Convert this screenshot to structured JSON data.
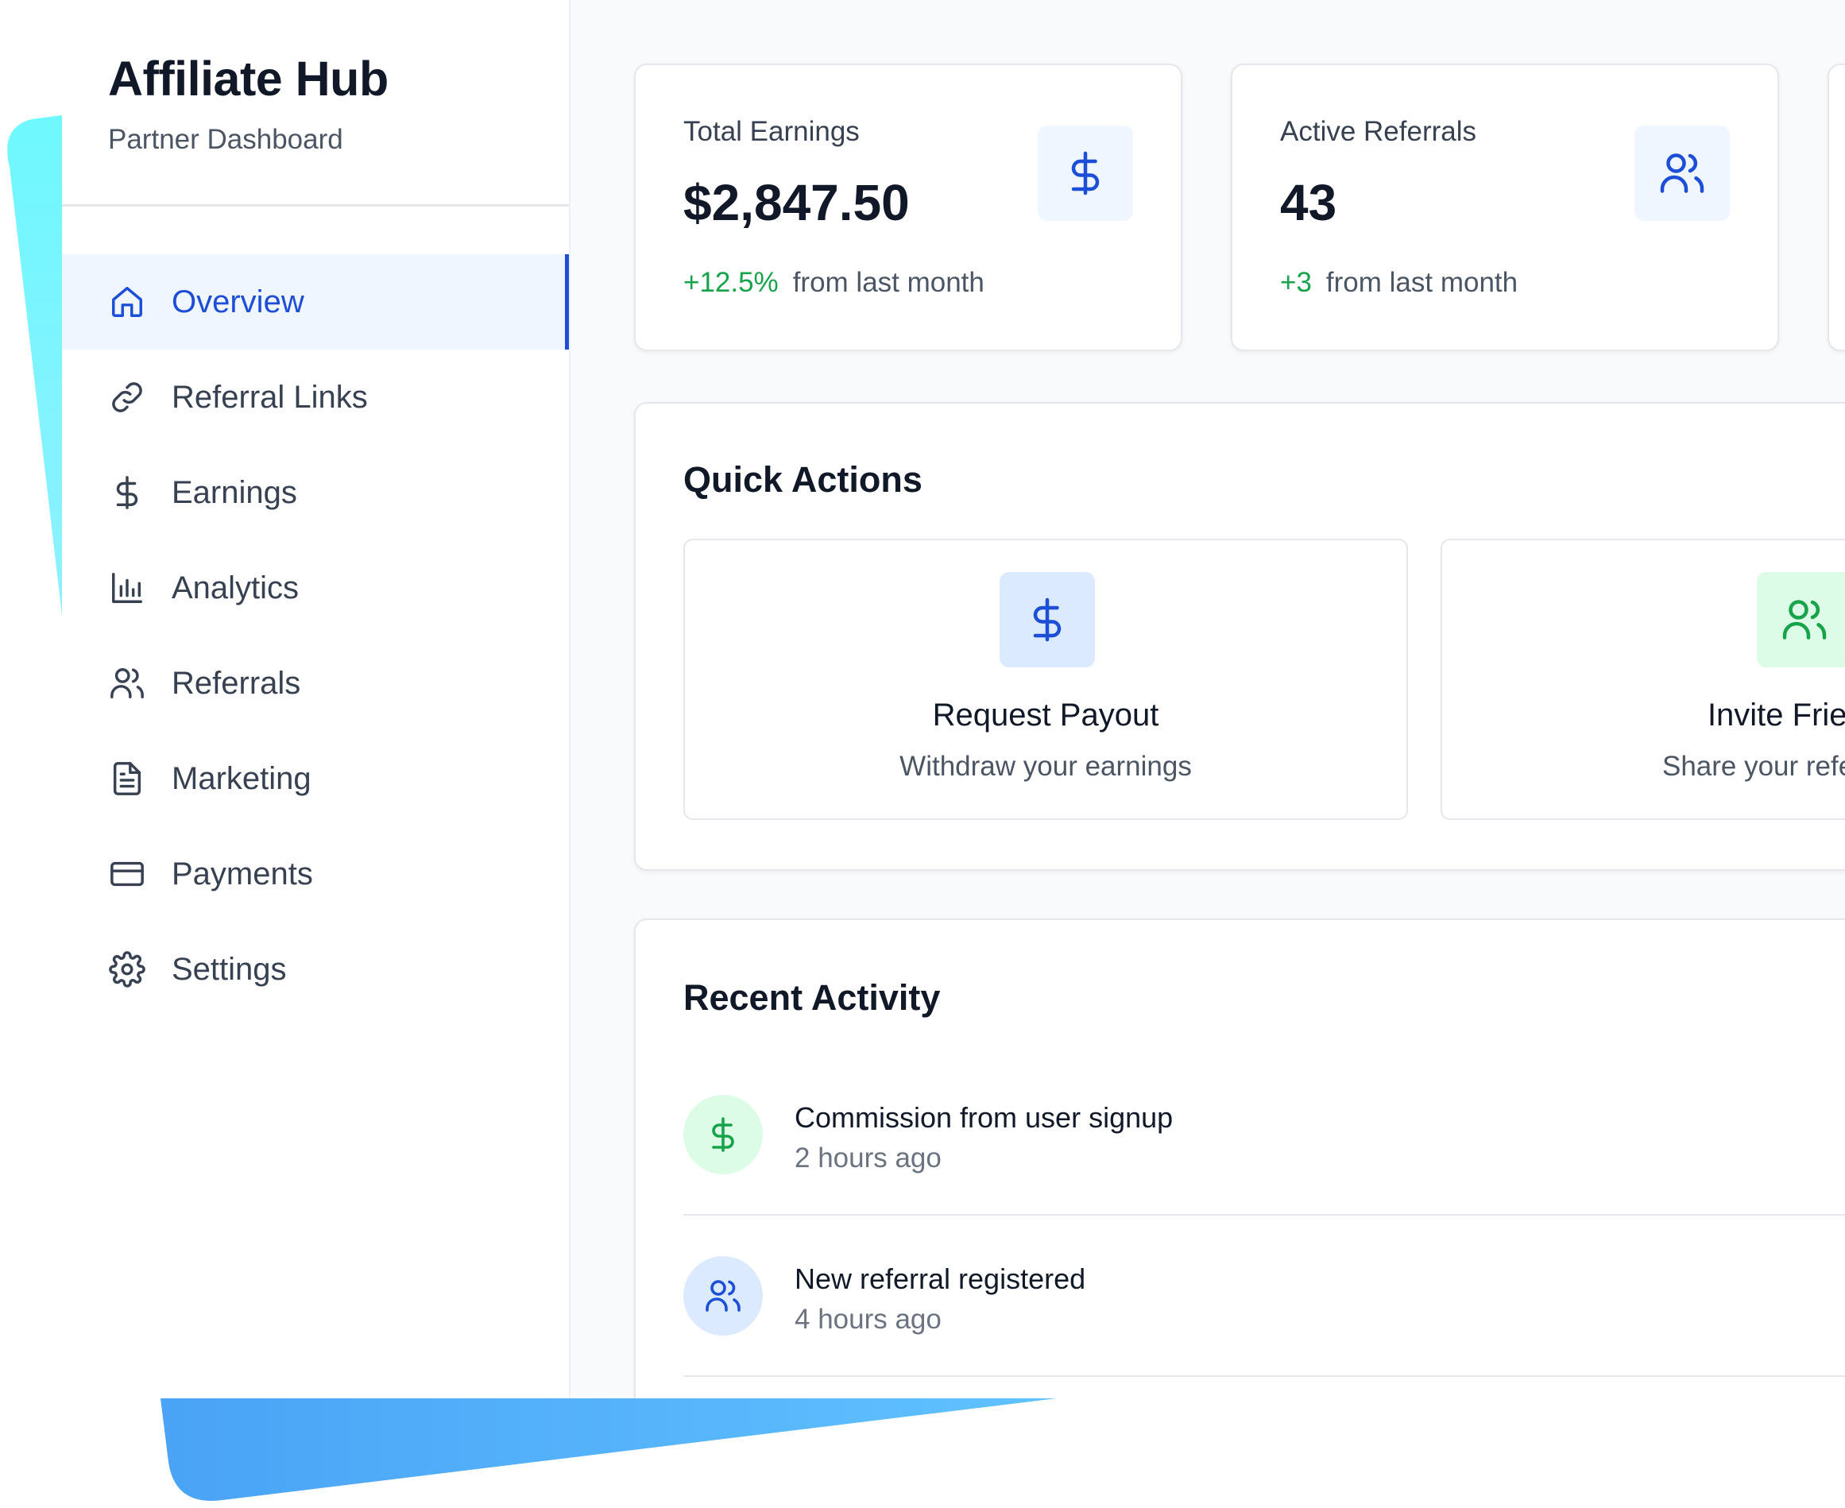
{
  "brand": {
    "title": "Affiliate Hub",
    "subtitle": "Partner Dashboard"
  },
  "nav": {
    "items": [
      {
        "label": "Overview",
        "icon": "home-icon",
        "active": true
      },
      {
        "label": "Referral Links",
        "icon": "link-icon"
      },
      {
        "label": "Earnings",
        "icon": "dollar-icon"
      },
      {
        "label": "Analytics",
        "icon": "bar-chart-icon"
      },
      {
        "label": "Referrals",
        "icon": "users-icon"
      },
      {
        "label": "Marketing",
        "icon": "document-icon"
      },
      {
        "label": "Payments",
        "icon": "credit-card-icon"
      },
      {
        "label": "Settings",
        "icon": "gear-icon"
      }
    ]
  },
  "stats": [
    {
      "label": "Total Earnings",
      "value": "$2,847.50",
      "change": "+12.5%",
      "change_suffix": "from last month",
      "icon": "dollar-icon"
    },
    {
      "label": "Active Referrals",
      "value": "43",
      "change": "+3",
      "change_suffix": "from last month",
      "icon": "users-icon"
    }
  ],
  "quick_actions": {
    "title": "Quick Actions",
    "items": [
      {
        "title": "Request Payout",
        "subtitle": "Withdraw your earnings",
        "icon": "dollar-icon"
      },
      {
        "title": "Invite Friends",
        "subtitle": "Share your referral link",
        "icon": "users-icon"
      }
    ]
  },
  "recent_activity": {
    "title": "Recent Activity",
    "items": [
      {
        "title": "Commission from user signup",
        "time": "2 hours ago",
        "icon": "dollar-icon"
      },
      {
        "title": "New referral registered",
        "time": "4 hours ago",
        "icon": "users-icon"
      }
    ]
  },
  "colors": {
    "accent": "#1d4ed8",
    "positive": "#16a34a",
    "active_bg": "#eff6ff",
    "green_bg": "#dcfce7",
    "deco_cyan": "#6ff7ff",
    "deco_blue": "#4aa8f8"
  }
}
